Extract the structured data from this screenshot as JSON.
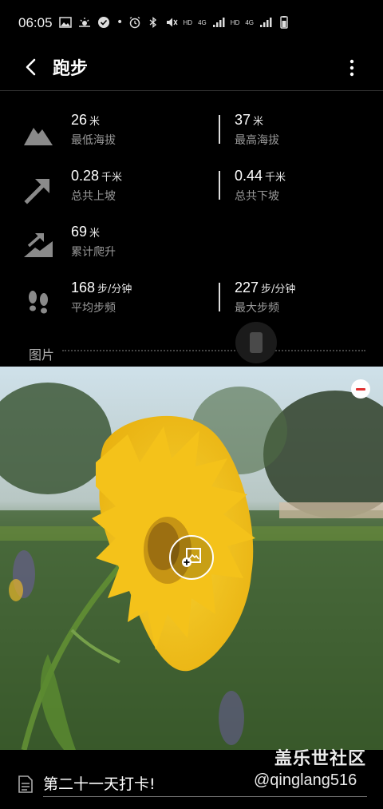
{
  "status_bar": {
    "time": "06:05",
    "dot": "•",
    "hd1": "HD",
    "lte1": "4G",
    "hd2": "HD",
    "lte2": "4G"
  },
  "app_bar": {
    "title": "跑步"
  },
  "stats": [
    {
      "left": {
        "value": "26",
        "unit": "米",
        "label": "最低海拔"
      },
      "right": {
        "value": "37",
        "unit": "米",
        "label": "最高海拔"
      },
      "icon": "mountain-icon"
    },
    {
      "left": {
        "value": "0.28",
        "unit": "千米",
        "label": "总共上坡"
      },
      "right": {
        "value": "0.44",
        "unit": "千米",
        "label": "总共下坡"
      },
      "icon": "uphill-arrow-icon"
    },
    {
      "left": {
        "value": "69",
        "unit": "米",
        "label": "累计爬升"
      },
      "icon": "climb-icon"
    },
    {
      "left": {
        "value": "168",
        "unit": "步/分钟",
        "label": "平均步频"
      },
      "right": {
        "value": "227",
        "unit": "步/分钟",
        "label": "最大步频"
      },
      "icon": "footprints-icon"
    }
  ],
  "photos": {
    "label": "图片"
  },
  "bottom": {
    "note": "第二十一天打卡!"
  },
  "watermark": {
    "title": "盖乐世社区",
    "user": "@qinglang516"
  },
  "colors": {
    "background": "#000000",
    "flower": "#f4c21a",
    "remove": "#e03030"
  }
}
